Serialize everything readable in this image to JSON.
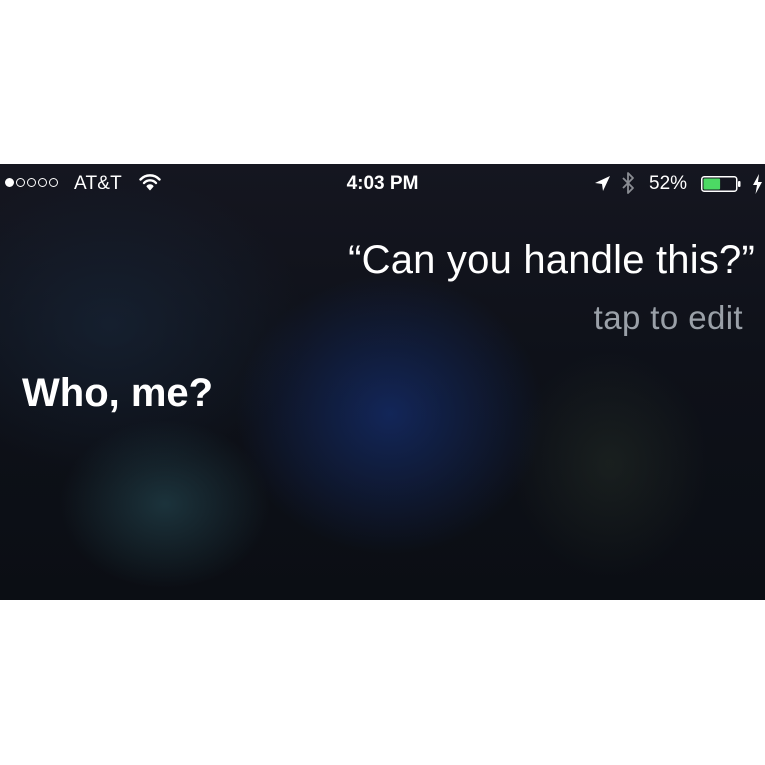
{
  "status_bar": {
    "signal_bars_total": 5,
    "signal_bars_filled": 1,
    "carrier": "AT&T",
    "time": "4:03 PM",
    "battery_percent": "52%",
    "battery_level": 0.52,
    "battery_color": "#4cd964",
    "icons": [
      "wifi-icon",
      "location-icon",
      "bluetooth-icon",
      "battery-icon",
      "charging-bolt-icon"
    ]
  },
  "siri": {
    "user_query": "“Can you handle this?”",
    "edit_hint": "tap to edit",
    "response": "Who, me?"
  }
}
